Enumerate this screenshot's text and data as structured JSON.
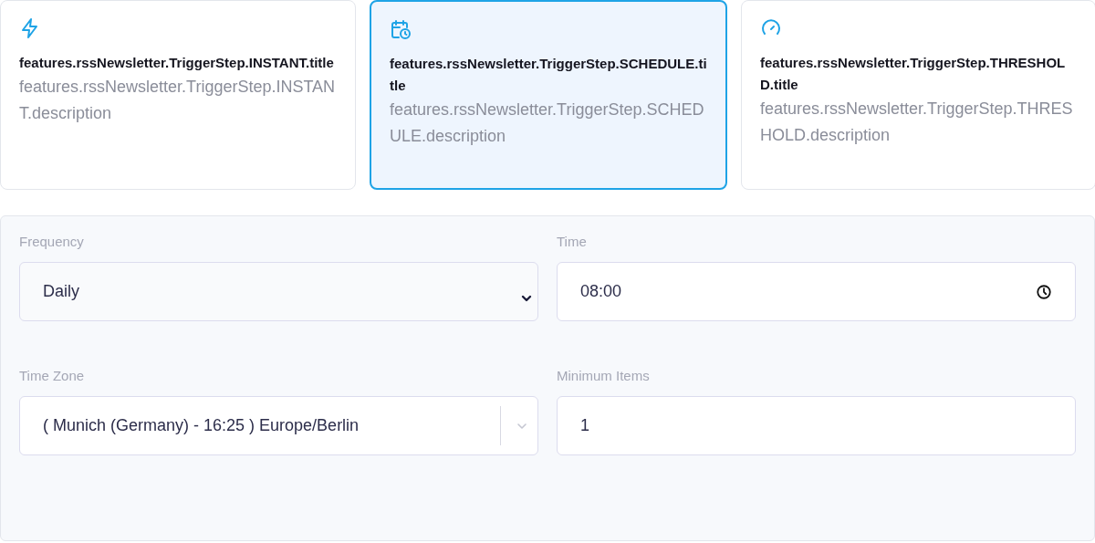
{
  "trigger_options": [
    {
      "kind": "instant",
      "title": "features.rssNewsletter.TriggerStep.INSTANT.title",
      "description": "features.rssNewsletter.TriggerStep.INSTANT.description",
      "selected": false
    },
    {
      "kind": "schedule",
      "title": "features.rssNewsletter.TriggerStep.SCHEDULE.title",
      "description": "features.rssNewsletter.TriggerStep.SCHEDULE.description",
      "selected": true
    },
    {
      "kind": "threshold",
      "title": "features.rssNewsletter.TriggerStep.THRESHOLD.title",
      "description": "features.rssNewsletter.TriggerStep.THRESHOLD.description",
      "selected": false
    }
  ],
  "fields": [
    {
      "kind": "select",
      "label": "Frequency",
      "value": "Daily"
    },
    {
      "kind": "time",
      "label": "Time",
      "value": "08:00"
    },
    {
      "kind": "combobox",
      "label": "Time Zone",
      "value": "( Munich (Germany) - 16:25 ) Europe/Berlin"
    },
    {
      "kind": "text",
      "label": "Minimum Items",
      "value": "1"
    }
  ]
}
